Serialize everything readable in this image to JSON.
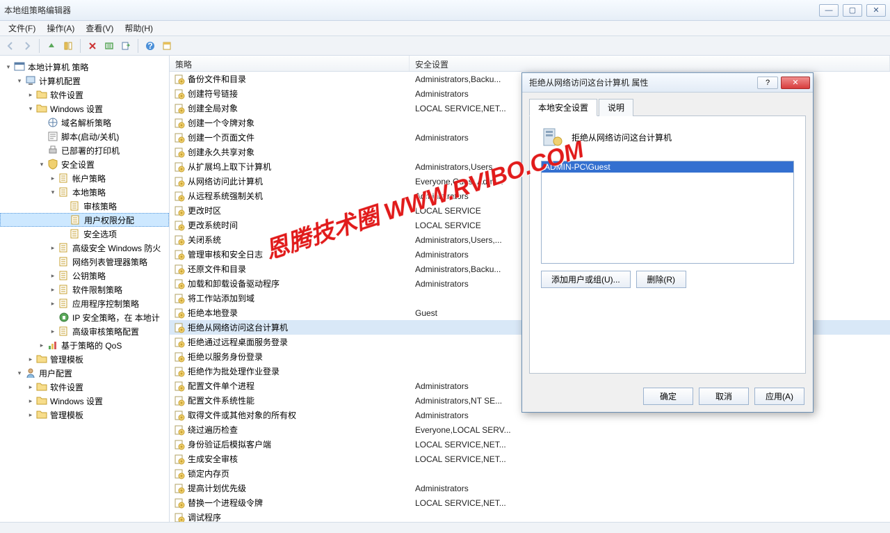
{
  "window": {
    "title": "本地组策略编辑器"
  },
  "menus": [
    "文件(F)",
    "操作(A)",
    "查看(V)",
    "帮助(H)"
  ],
  "toolbar_icons": [
    "back",
    "forward",
    "up",
    "folder",
    "delete",
    "refresh",
    "export",
    "help",
    "properties"
  ],
  "tree": [
    {
      "depth": 0,
      "exp": "▾",
      "icon": "console",
      "label": "本地计算机 策略"
    },
    {
      "depth": 1,
      "exp": "▾",
      "icon": "computer",
      "label": "计算机配置"
    },
    {
      "depth": 2,
      "exp": "▸",
      "icon": "folder",
      "label": "软件设置"
    },
    {
      "depth": 2,
      "exp": "▾",
      "icon": "folder",
      "label": "Windows 设置"
    },
    {
      "depth": 3,
      "exp": "",
      "icon": "dns",
      "label": "域名解析策略"
    },
    {
      "depth": 3,
      "exp": "",
      "icon": "script",
      "label": "脚本(启动/关机)"
    },
    {
      "depth": 3,
      "exp": "",
      "icon": "printer",
      "label": "已部署的打印机"
    },
    {
      "depth": 3,
      "exp": "▾",
      "icon": "security",
      "label": "安全设置"
    },
    {
      "depth": 4,
      "exp": "▸",
      "icon": "policy",
      "label": "帐户策略"
    },
    {
      "depth": 4,
      "exp": "▾",
      "icon": "policy",
      "label": "本地策略"
    },
    {
      "depth": 5,
      "exp": "",
      "icon": "policy",
      "label": "审核策略"
    },
    {
      "depth": 5,
      "exp": "",
      "icon": "policy",
      "label": "用户权限分配",
      "selected": true
    },
    {
      "depth": 5,
      "exp": "",
      "icon": "policy",
      "label": "安全选项"
    },
    {
      "depth": 4,
      "exp": "▸",
      "icon": "policy",
      "label": "高级安全 Windows 防火"
    },
    {
      "depth": 4,
      "exp": "",
      "icon": "policy",
      "label": "网络列表管理器策略"
    },
    {
      "depth": 4,
      "exp": "▸",
      "icon": "policy",
      "label": "公钥策略"
    },
    {
      "depth": 4,
      "exp": "▸",
      "icon": "policy",
      "label": "软件限制策略"
    },
    {
      "depth": 4,
      "exp": "▸",
      "icon": "policy",
      "label": "应用程序控制策略"
    },
    {
      "depth": 4,
      "exp": "",
      "icon": "ipsec",
      "label": "IP 安全策略，在 本地计"
    },
    {
      "depth": 4,
      "exp": "▸",
      "icon": "policy",
      "label": "高级审核策略配置"
    },
    {
      "depth": 3,
      "exp": "▸",
      "icon": "qos",
      "label": "基于策略的 QoS"
    },
    {
      "depth": 2,
      "exp": "▸",
      "icon": "folder",
      "label": "管理模板"
    },
    {
      "depth": 1,
      "exp": "▾",
      "icon": "user",
      "label": "用户配置"
    },
    {
      "depth": 2,
      "exp": "▸",
      "icon": "folder",
      "label": "软件设置"
    },
    {
      "depth": 2,
      "exp": "▸",
      "icon": "folder",
      "label": "Windows 设置"
    },
    {
      "depth": 2,
      "exp": "▸",
      "icon": "folder",
      "label": "管理模板"
    }
  ],
  "list": {
    "columns": [
      "策略",
      "安全设置"
    ],
    "rows": [
      {
        "p": "备份文件和目录",
        "s": "Administrators,Backu..."
      },
      {
        "p": "创建符号链接",
        "s": "Administrators"
      },
      {
        "p": "创建全局对象",
        "s": "LOCAL SERVICE,NET..."
      },
      {
        "p": "创建一个令牌对象",
        "s": ""
      },
      {
        "p": "创建一个页面文件",
        "s": "Administrators"
      },
      {
        "p": "创建永久共享对象",
        "s": ""
      },
      {
        "p": "从扩展坞上取下计算机",
        "s": "Administrators,Users"
      },
      {
        "p": "从网络访问此计算机",
        "s": "Everyone,Guest,Admi..."
      },
      {
        "p": "从远程系统强制关机",
        "s": "Administrators"
      },
      {
        "p": "更改时区",
        "s": "LOCAL SERVICE"
      },
      {
        "p": "更改系统时间",
        "s": "LOCAL SERVICE"
      },
      {
        "p": "关闭系统",
        "s": "Administrators,Users,..."
      },
      {
        "p": "管理审核和安全日志",
        "s": "Administrators"
      },
      {
        "p": "还原文件和目录",
        "s": "Administrators,Backu..."
      },
      {
        "p": "加载和卸载设备驱动程序",
        "s": "Administrators"
      },
      {
        "p": "将工作站添加到域",
        "s": ""
      },
      {
        "p": "拒绝本地登录",
        "s": "Guest"
      },
      {
        "p": "拒绝从网络访问这台计算机",
        "s": "",
        "selected": true
      },
      {
        "p": "拒绝通过远程桌面服务登录",
        "s": ""
      },
      {
        "p": "拒绝以服务身份登录",
        "s": ""
      },
      {
        "p": "拒绝作为批处理作业登录",
        "s": ""
      },
      {
        "p": "配置文件单个进程",
        "s": "Administrators"
      },
      {
        "p": "配置文件系统性能",
        "s": "Administrators,NT SE..."
      },
      {
        "p": "取得文件或其他对象的所有权",
        "s": "Administrators"
      },
      {
        "p": "绕过遍历检查",
        "s": "Everyone,LOCAL SERV..."
      },
      {
        "p": "身份验证后模拟客户端",
        "s": "LOCAL SERVICE,NET..."
      },
      {
        "p": "生成安全审核",
        "s": "LOCAL SERVICE,NET..."
      },
      {
        "p": "锁定内存页",
        "s": ""
      },
      {
        "p": "提高计划优先级",
        "s": "Administrators"
      },
      {
        "p": "替换一个进程级令牌",
        "s": "LOCAL SERVICE,NET..."
      },
      {
        "p": "调试程序",
        "s": ""
      }
    ]
  },
  "dialog": {
    "title": "拒绝从网络访问这台计算机 属性",
    "tabs": [
      "本地安全设置",
      "说明"
    ],
    "heading": "拒绝从网络访问这台计算机",
    "entries": [
      "ADMIN-PC\\Guest"
    ],
    "add_btn": "添加用户或组(U)...",
    "remove_btn": "删除(R)",
    "ok": "确定",
    "cancel": "取消",
    "apply": "应用(A)"
  },
  "watermark": "恩腾技术圈 WWW.RVIBO.COM"
}
